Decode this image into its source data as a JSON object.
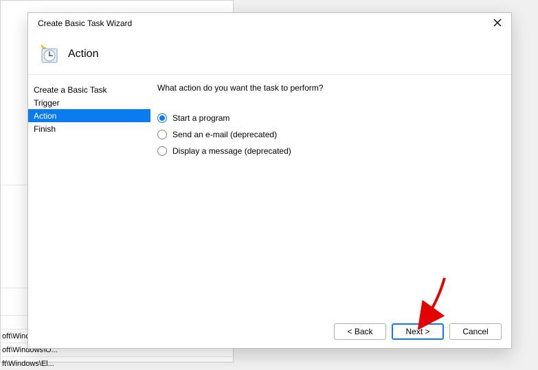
{
  "window": {
    "title": "Create Basic Task Wizard"
  },
  "header": {
    "title": "Action"
  },
  "sidebar": {
    "items": [
      {
        "label": "Create a Basic Task"
      },
      {
        "label": "Trigger"
      },
      {
        "label": "Action"
      },
      {
        "label": "Finish"
      }
    ]
  },
  "content": {
    "question": "What action do you want the task to perform?",
    "options": [
      {
        "label": "Start a program"
      },
      {
        "label": "Send an e-mail (deprecated)"
      },
      {
        "label": "Display a message (deprecated)"
      }
    ]
  },
  "footer": {
    "back": "< Back",
    "next": "Next >",
    "cancel": "Cancel"
  },
  "background": {
    "row1": "oft\\Winc",
    "row2": "oft\\Windows\\O...",
    "row3": "ft\\Windows\\El..."
  }
}
